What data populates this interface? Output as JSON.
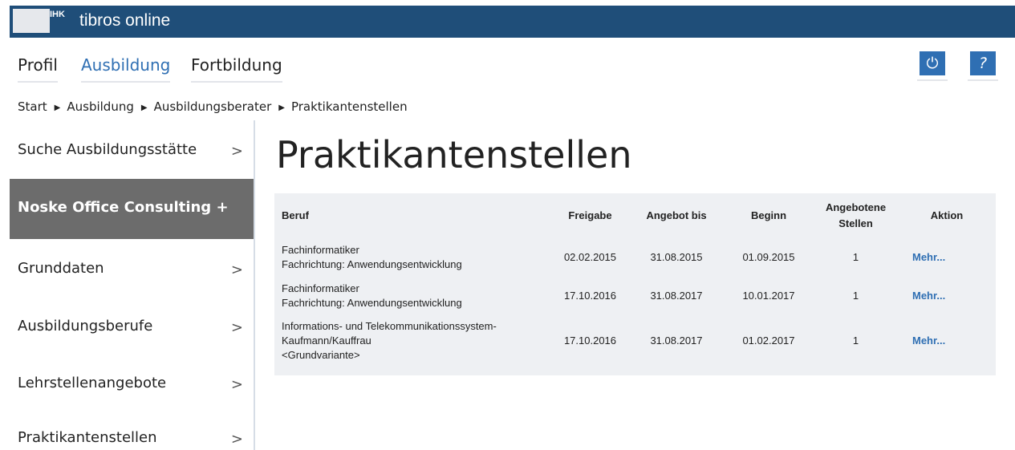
{
  "header": {
    "logo_text": "IHK",
    "app_title": "tibros online"
  },
  "main_nav": {
    "tabs": [
      {
        "label": "Profil",
        "active": false
      },
      {
        "label": "Ausbildung",
        "active": true
      },
      {
        "label": "Fortbildung",
        "active": false
      }
    ],
    "power_icon_glyph": "⏻",
    "help_icon_glyph": "?"
  },
  "breadcrumb": [
    "Start",
    "Ausbildung",
    "Ausbildungsberater",
    "Praktikantenstellen"
  ],
  "sidebar": {
    "items": [
      {
        "label": "Suche Ausbildungsstätte",
        "chevron": ">",
        "active": false
      },
      {
        "label": "Noske Office Consulting +",
        "chevron": "",
        "active": true
      },
      {
        "label": "Grunddaten",
        "chevron": ">",
        "active": false
      },
      {
        "label": "Ausbildungsberufe",
        "chevron": ">",
        "active": false
      },
      {
        "label": "Lehrstellenangebote",
        "chevron": ">",
        "active": false
      },
      {
        "label": "Praktikantenstellen",
        "chevron": ">",
        "active": false
      }
    ]
  },
  "page_title": "Praktikantenstellen",
  "table": {
    "headers": {
      "beruf": "Beruf",
      "freigabe": "Freigabe",
      "angebot_bis": "Angebot bis",
      "beginn": "Beginn",
      "angebotene_1": "Angebotene",
      "angebotene_2": "Stellen",
      "aktion": "Aktion"
    },
    "rows": [
      {
        "beruf_lines": [
          "Fachinformatiker",
          "Fachrichtung: Anwendungsentwicklung",
          ""
        ],
        "freigabe": "02.02.2015",
        "angebot_bis": "31.08.2015",
        "beginn": "01.09.2015",
        "stellen": "1",
        "aktion": "Mehr..."
      },
      {
        "beruf_lines": [
          "Fachinformatiker",
          "Fachrichtung: Anwendungsentwicklung",
          ""
        ],
        "freigabe": "17.10.2016",
        "angebot_bis": "31.08.2017",
        "beginn": "10.01.2017",
        "stellen": "1",
        "aktion": "Mehr..."
      },
      {
        "beruf_lines": [
          "Informations- und Telekommunikationssystem-",
          "Kaufmann/Kauffrau",
          "<Grundvariante>"
        ],
        "freigabe": "17.10.2016",
        "angebot_bis": "31.08.2017",
        "beginn": "01.02.2017",
        "stellen": "1",
        "aktion": "Mehr..."
      }
    ]
  },
  "colors": {
    "header_bg": "#1f4e79",
    "accent": "#2f6fb3",
    "sidebar_active_bg": "#6c6c6c",
    "table_bg": "#eef0f3"
  }
}
